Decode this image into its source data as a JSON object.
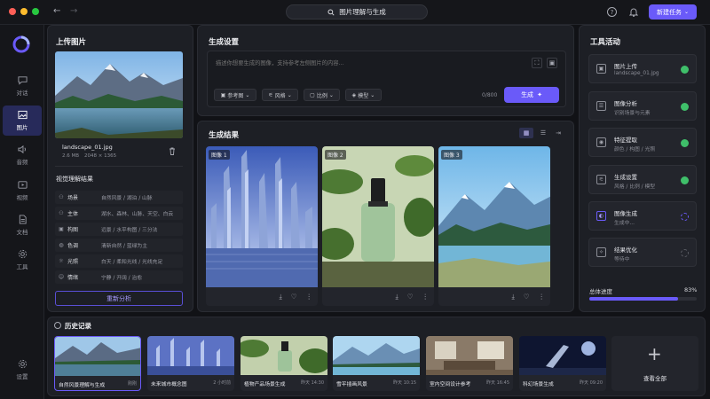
{
  "titlebar": {
    "title": "图片理解与生成",
    "new_task": "新建任务"
  },
  "sidebar": {
    "items": [
      {
        "label": "对话",
        "icon": "chat-icon"
      },
      {
        "label": "图片",
        "icon": "image-icon"
      },
      {
        "label": "音频",
        "icon": "audio-icon"
      },
      {
        "label": "视频",
        "icon": "video-icon"
      },
      {
        "label": "文档",
        "icon": "document-icon"
      },
      {
        "label": "工具",
        "icon": "tools-icon"
      }
    ],
    "settings": "设置"
  },
  "upload": {
    "title": "上传图片",
    "file_name": "landscape_01.jpg",
    "file_size": "2.6 MB",
    "file_dims": "2048 × 1365",
    "vision_title": "视觉理解结果",
    "rows": [
      {
        "k": "场景",
        "v": "自然风景 / 湖泊 / 山脉",
        "icon": "person-icon"
      },
      {
        "k": "主体",
        "v": "湖水、森林、山脉、天空、白云",
        "icon": "person-icon"
      },
      {
        "k": "构图",
        "v": "远景 / 水平构图 / 三分法",
        "icon": "image-icon"
      },
      {
        "k": "色调",
        "v": "清新自然 / 蓝绿为主",
        "icon": "palette-icon"
      },
      {
        "k": "光照",
        "v": "白天 / 柔和光线 / 光线充足",
        "icon": "sun-icon"
      },
      {
        "k": "情绪",
        "v": "宁静 / 开阔 / 治愈",
        "icon": "smile-icon"
      }
    ],
    "reanalyze": "重新分析"
  },
  "gen_settings": {
    "title": "生成设置",
    "placeholder": "描述你想要生成的图像，支持参考左侧图片的内容...",
    "chips": [
      "参考图",
      "风格",
      "比例",
      "模型"
    ],
    "counter": "0/800",
    "generate": "生成"
  },
  "results": {
    "title": "生成结果",
    "cards": [
      "图像 1",
      "图像 2",
      "图像 3"
    ]
  },
  "activity": {
    "title": "工具活动",
    "items": [
      {
        "t1": "图片上传",
        "t2": "landscape_01.jpg",
        "status": "done"
      },
      {
        "t1": "图像分析",
        "t2": "识别场景与元素",
        "status": "done"
      },
      {
        "t1": "特征提取",
        "t2": "颜色 / 构图 / 光照",
        "status": "done"
      },
      {
        "t1": "生成设置",
        "t2": "风格 / 比例 / 模型",
        "status": "done"
      },
      {
        "t1": "图像生成",
        "t2": "生成中...",
        "status": "running"
      },
      {
        "t1": "结果优化",
        "t2": "等待中",
        "status": "waiting"
      }
    ],
    "progress_label": "总体进度",
    "progress_text": "83%",
    "progress": 0.83
  },
  "history": {
    "title": "历史记录",
    "items": [
      {
        "name": "自然风景理解与生成",
        "time": "刚刚"
      },
      {
        "name": "未来城市概念图",
        "time": "2 小时前"
      },
      {
        "name": "植物产品场景生成",
        "time": "昨天 14:30"
      },
      {
        "name": "雪平插画风景",
        "time": "昨天 10:15"
      },
      {
        "name": "室内空间设计参考",
        "time": "昨天 16:45"
      },
      {
        "name": "科幻场景生成",
        "time": "昨天 09:20"
      }
    ],
    "view_all": "查看全部"
  },
  "colors": {
    "accent": "#6a5af9",
    "success": "#3fbf6a"
  }
}
